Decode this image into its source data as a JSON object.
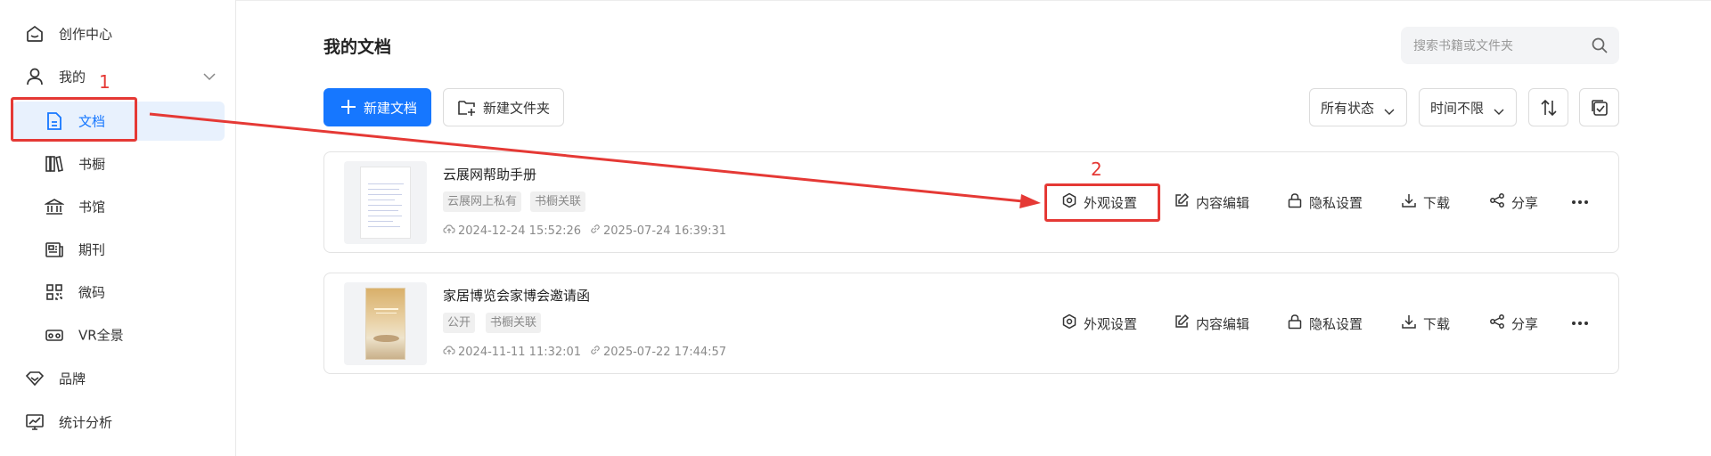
{
  "sidebar": {
    "items": [
      {
        "label": "创作中心",
        "icon": "home-icon"
      },
      {
        "label": "我的",
        "icon": "user-icon"
      },
      {
        "label": "文档",
        "icon": "document-icon"
      },
      {
        "label": "书橱",
        "icon": "bookshelf-icon"
      },
      {
        "label": "书馆",
        "icon": "library-icon"
      },
      {
        "label": "期刊",
        "icon": "journal-icon"
      },
      {
        "label": "微码",
        "icon": "qrcode-icon"
      },
      {
        "label": "VR全景",
        "icon": "vr-icon"
      },
      {
        "label": "品牌",
        "icon": "diamond-icon"
      },
      {
        "label": "统计分析",
        "icon": "chart-icon"
      }
    ]
  },
  "header": {
    "title": "我的文档",
    "search_placeholder": "搜索书籍或文件夹"
  },
  "toolbar": {
    "new_doc": "新建文档",
    "new_folder": "新建文件夹",
    "status_filter": "所有状态",
    "time_filter": "时间不限"
  },
  "documents": [
    {
      "title": "云展网帮助手册",
      "tags": [
        "云展网上私有",
        "书橱关联"
      ],
      "created": "2024-12-24 15:52:26",
      "updated": "2025-07-24 16:39:31"
    },
    {
      "title": "家居博览会家博会邀请函",
      "tags": [
        "公开",
        "书橱关联"
      ],
      "created": "2024-11-11 11:32:01",
      "updated": "2025-07-22 17:44:57"
    }
  ],
  "actions": {
    "appearance": "外观设置",
    "edit": "内容编辑",
    "privacy": "隐私设置",
    "download": "下载",
    "share": "分享"
  },
  "annotations": {
    "step1": "1",
    "step2": "2"
  },
  "colors": {
    "primary": "#1677ff",
    "active_bg": "#e8f1fd",
    "annotation": "#e53935"
  }
}
